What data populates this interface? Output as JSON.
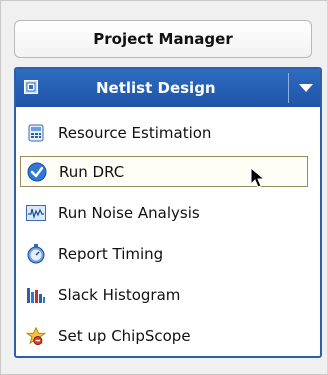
{
  "project_manager": {
    "label": "Project Manager"
  },
  "netlist": {
    "title": "Netlist Design",
    "items": [
      {
        "label": "Resource Estimation",
        "icon": "calculator-icon"
      },
      {
        "label": "Run DRC",
        "icon": "check-circle-icon",
        "selected": true
      },
      {
        "label": "Run Noise Analysis",
        "icon": "waveform-icon"
      },
      {
        "label": "Report Timing",
        "icon": "stopwatch-icon"
      },
      {
        "label": "Slack Histogram",
        "icon": "histogram-icon"
      },
      {
        "label": "Set up ChipScope",
        "icon": "chipscope-icon"
      }
    ]
  },
  "colors": {
    "header": "#1e54a6",
    "selection_border": "#9a8a62",
    "accent": "#2f5ea6"
  }
}
